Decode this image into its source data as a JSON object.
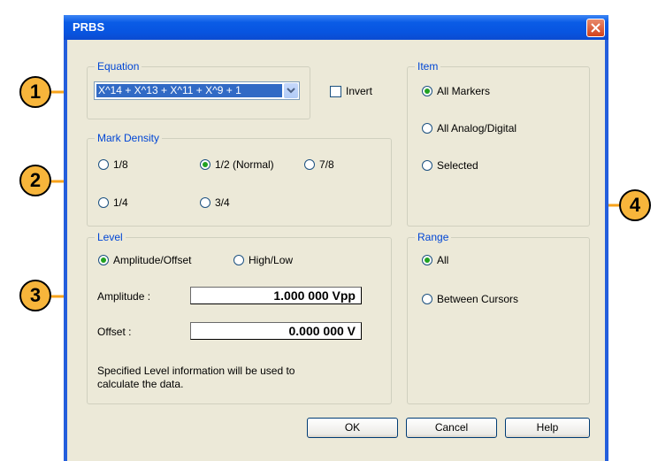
{
  "window": {
    "title": "PRBS"
  },
  "equation": {
    "group_label": "Equation",
    "selected_value": "X^14 + X^13 + X^11 + X^9 + 1",
    "invert_label": "Invert",
    "invert_checked": false
  },
  "mark_density": {
    "group_label": "Mark Density",
    "options": [
      "1/8",
      "1/2 (Normal)",
      "7/8",
      "1/4",
      "3/4"
    ],
    "selected": "1/2 (Normal)"
  },
  "level": {
    "group_label": "Level",
    "modes": [
      "Amplitude/Offset",
      "High/Low"
    ],
    "selected_mode": "Amplitude/Offset",
    "amplitude_label": "Amplitude :",
    "amplitude_value": "1.000 000 Vpp",
    "offset_label": "Offset :",
    "offset_value": "0.000 000 V",
    "note": "Specified Level information will be used to calculate the data."
  },
  "item": {
    "group_label": "Item",
    "options": [
      "All Markers",
      "All Analog/Digital",
      "Selected"
    ],
    "selected": "All Markers"
  },
  "range": {
    "group_label": "Range",
    "options": [
      "All",
      "Between Cursors"
    ],
    "selected": "All"
  },
  "buttons": {
    "ok": "OK",
    "cancel": "Cancel",
    "help": "Help"
  },
  "callouts": [
    "1",
    "2",
    "3",
    "4"
  ],
  "colors": {
    "callout": "#f7b53b",
    "callout_line": "#f7a21a",
    "titlebar": "#0a5ce6",
    "group_label": "#0046d5"
  }
}
